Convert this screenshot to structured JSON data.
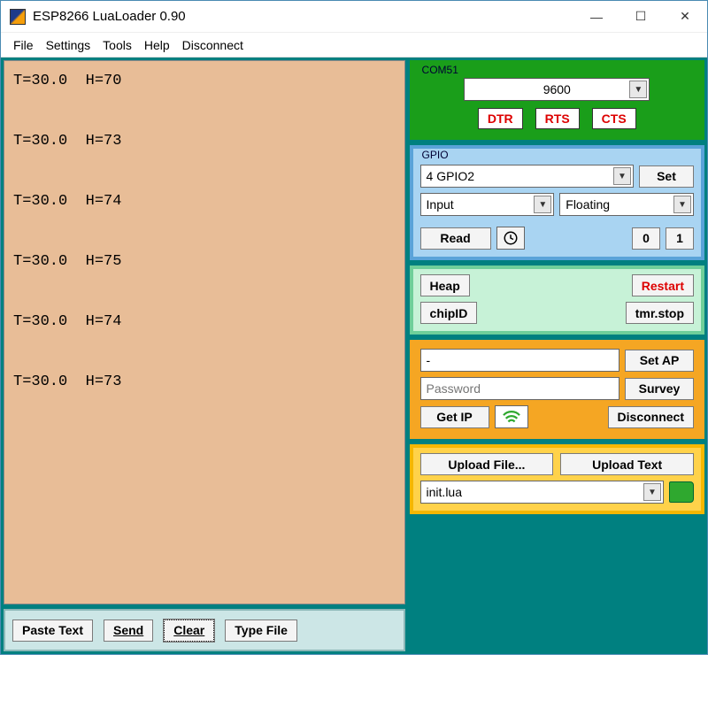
{
  "window": {
    "title": "ESP8266 LuaLoader 0.90"
  },
  "menu": {
    "file": "File",
    "settings": "Settings",
    "tools": "Tools",
    "help": "Help",
    "disconnect": "Disconnect"
  },
  "terminal": {
    "content": "T=30.0  H=70\n\nT=30.0  H=73\n\nT=30.0  H=74\n\nT=30.0  H=75\n\nT=30.0  H=74\n\nT=30.0  H=73"
  },
  "bottom": {
    "paste": "Paste Text",
    "send": "Send",
    "clear": "Clear",
    "typefile": "Type File"
  },
  "com": {
    "title": "COM51",
    "baud": "9600",
    "dtr": "DTR",
    "rts": "RTS",
    "cts": "CTS"
  },
  "gpio": {
    "title": "GPIO",
    "pin": "4 GPIO2",
    "set": "Set",
    "mode": "Input",
    "pull": "Floating",
    "read": "Read",
    "zero": "0",
    "one": "1"
  },
  "sys": {
    "heap": "Heap",
    "restart": "Restart",
    "chipid": "chipID",
    "tmrstop": "tmr.stop"
  },
  "wifi": {
    "ssid": "-",
    "password_placeholder": "Password",
    "setap": "Set AP",
    "survey": "Survey",
    "getip": "Get IP",
    "disconnect": "Disconnect"
  },
  "upload": {
    "uploadfile": "Upload File...",
    "uploadtext": "Upload Text",
    "filename": "init.lua"
  }
}
